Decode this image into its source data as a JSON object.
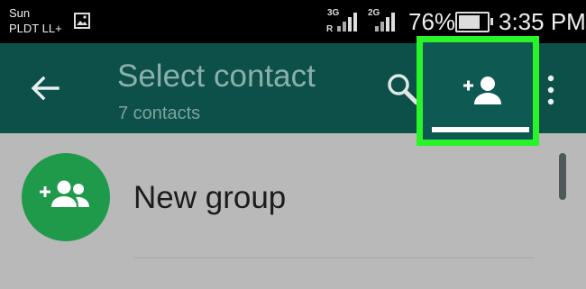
{
  "status_bar": {
    "carrier_line1": "Sun",
    "carrier_line2": "PLDT LL+",
    "network1": "3G",
    "network1_sub": "R",
    "network2": "2G",
    "battery_percent": "76%",
    "time": "3:35 PM",
    "battery_level": 0.76
  },
  "app_bar": {
    "title": "Select contact",
    "subtitle": "7 contacts",
    "icons": [
      "back-arrow-icon",
      "search-icon",
      "add-contact-icon",
      "more-options-icon"
    ]
  },
  "highlight_color": "#29f329",
  "list": {
    "items": [
      {
        "label": "New group",
        "icon": "group-add-icon"
      }
    ]
  },
  "colors": {
    "app_bar": "#0c5049",
    "accent_green": "#1f9a4b",
    "background": "#b9b9b9"
  }
}
